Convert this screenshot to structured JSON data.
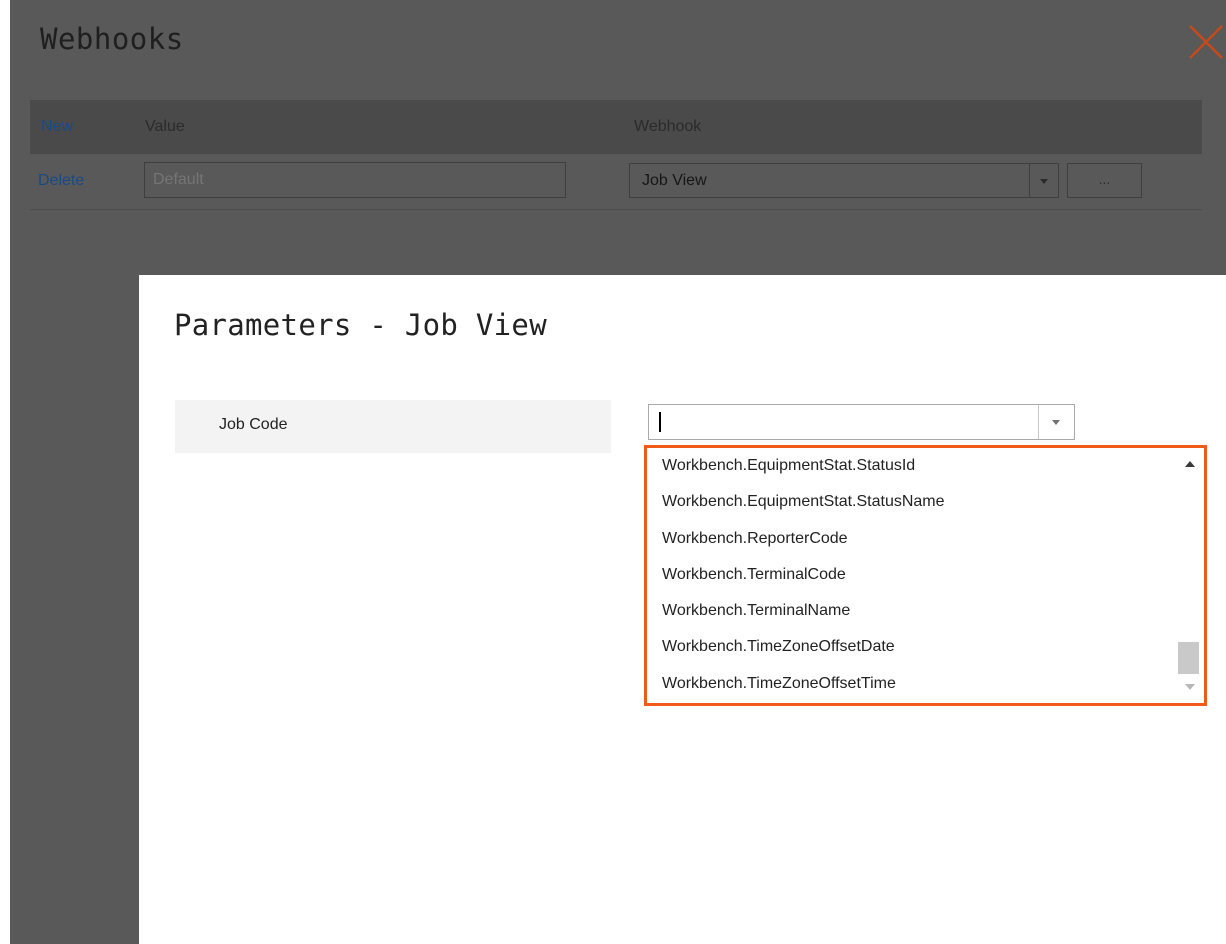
{
  "webhooks_window": {
    "title": "Webhooks",
    "header": {
      "new_label": "New",
      "value_col": "Value",
      "webhook_col": "Webhook"
    },
    "row": {
      "delete_label": "Delete",
      "value_placeholder": "Default",
      "webhook_selected": "Job View",
      "more_button": "..."
    }
  },
  "parameters_dialog": {
    "title": "Parameters - Job View",
    "field_label": "Job Code",
    "field_value": "",
    "options": [
      "Workbench.EquipmentStat.StatusId",
      "Workbench.EquipmentStat.StatusName",
      "Workbench.ReporterCode",
      "Workbench.TerminalCode",
      "Workbench.TerminalName",
      "Workbench.TimeZoneOffsetDate",
      "Workbench.TimeZoneOffsetTime"
    ]
  },
  "icons": {
    "close": "close-icon",
    "dropdown_arrow": "triangle-down-icon",
    "scroll_up": "triangle-up-icon",
    "scroll_down": "triangle-down-icon"
  },
  "colors": {
    "dropdown_highlight_border": "#f05a1a",
    "close_icon": "#c74a1a",
    "link_blue": "#1a4a86",
    "overlay_dim": "#595959"
  }
}
